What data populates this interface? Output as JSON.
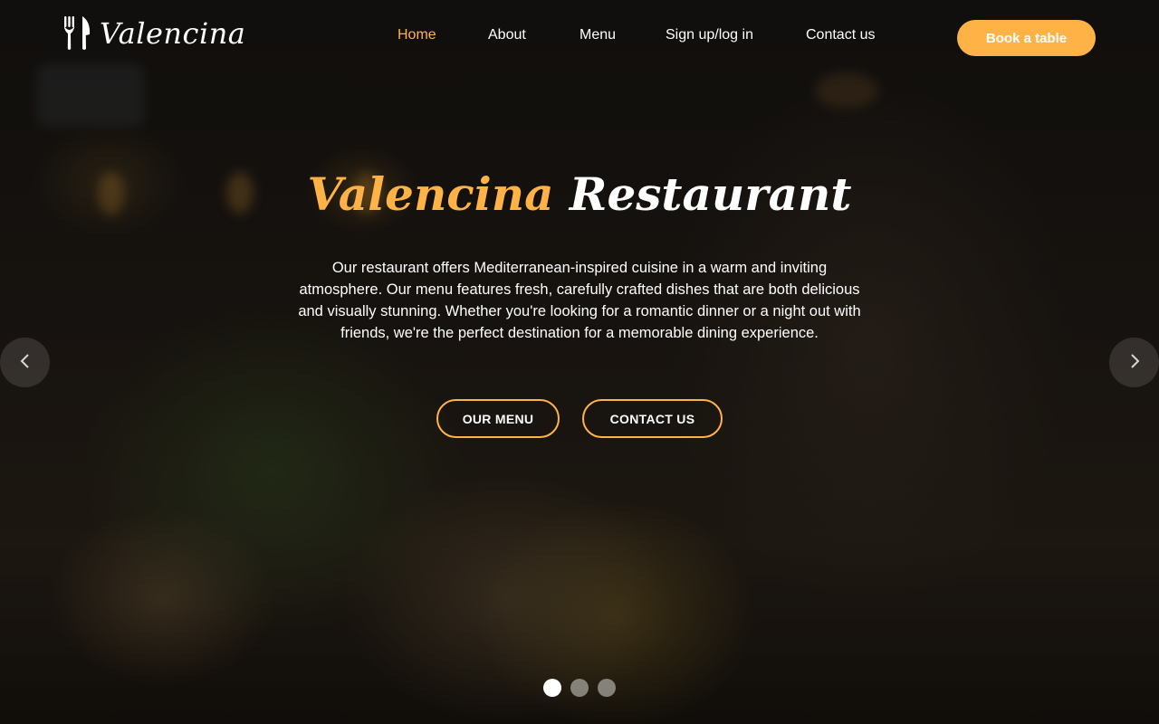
{
  "brand": {
    "name": "Valencina",
    "icon": "fork-knife-icon"
  },
  "nav": {
    "items": [
      {
        "label": "Home",
        "active": true
      },
      {
        "label": "About",
        "active": false
      },
      {
        "label": "Menu",
        "active": false
      },
      {
        "label": "Sign up/log in",
        "active": false
      },
      {
        "label": "Contact us",
        "active": false
      }
    ],
    "cta_label": "Book a table"
  },
  "hero": {
    "title_accent": "Valencina",
    "title_main": "Restaurant",
    "description": "Our restaurant offers Mediterranean-inspired cuisine in a warm and inviting atmosphere. Our menu features fresh, carefully crafted dishes that are both delicious and visually stunning. Whether you're looking for a romantic dinner or a night out with friends, we're the perfect destination for a memorable dining experience.",
    "buttons": {
      "menu_label": "OUR MENU",
      "contact_label": "CONTACT US"
    }
  },
  "carousel": {
    "prev_icon": "chevron-left-icon",
    "next_icon": "chevron-right-icon",
    "slide_count": 3,
    "active_slide": 1
  },
  "colors": {
    "accent": "#ffb347",
    "text": "#ffffff",
    "overlay": "rgba(0,0,0,0.35)"
  }
}
